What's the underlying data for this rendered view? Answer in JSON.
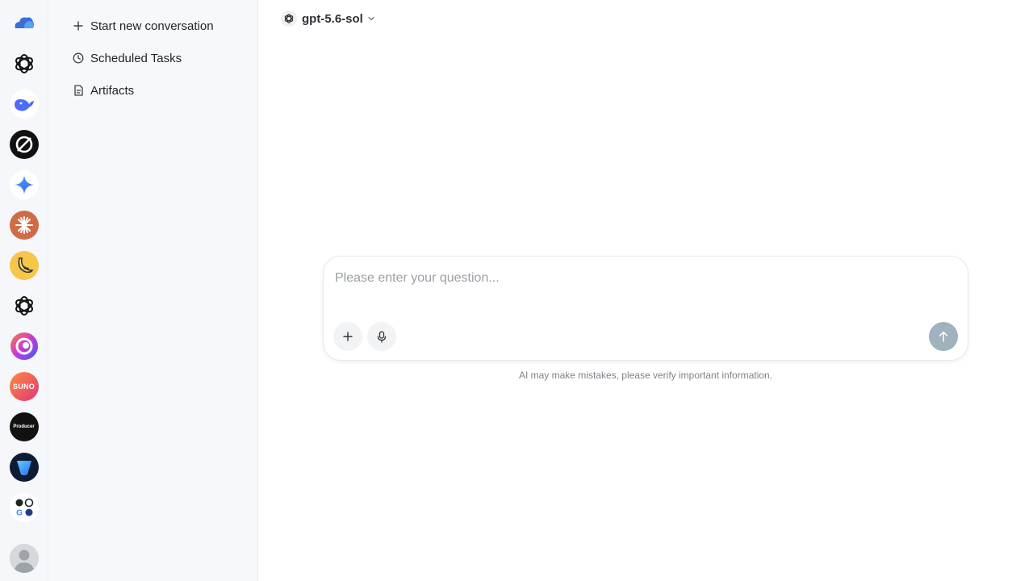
{
  "rail": {
    "apps": [
      {
        "icon": "cloud-logo-icon"
      },
      {
        "icon": "openai-logo-icon"
      },
      {
        "icon": "whale-logo-icon"
      },
      {
        "icon": "slash-circle-logo-icon"
      },
      {
        "icon": "sparkle-star-logo-icon"
      },
      {
        "icon": "starburst-logo-icon"
      },
      {
        "icon": "banana-logo-icon"
      },
      {
        "icon": "openai-logo-icon"
      },
      {
        "icon": "swirl-logo-icon"
      },
      {
        "icon": "suno-logo-icon",
        "label": "SUNO"
      },
      {
        "icon": "producer-logo-icon",
        "label": "Producer"
      },
      {
        "icon": "shield-v-logo-icon"
      },
      {
        "icon": "multi-ai-logo-icon",
        "label": "G"
      }
    ],
    "avatar": "user-avatar-icon"
  },
  "sidebar": {
    "items": [
      {
        "label": "Start new conversation",
        "icon": "plus-icon"
      },
      {
        "label": "Scheduled Tasks",
        "icon": "clock-icon"
      },
      {
        "label": "Artifacts",
        "icon": "file-icon"
      }
    ]
  },
  "header": {
    "model_name": "gpt-5.6-sol",
    "model_icon": "openai-logo-icon"
  },
  "composer": {
    "placeholder": "Please enter your question...",
    "value": "",
    "attach_icon": "plus-icon",
    "mic_icon": "microphone-icon",
    "send_icon": "arrow-up-icon"
  },
  "footer": {
    "disclaimer": "AI may make mistakes, please verify important information."
  },
  "colors": {
    "send_button": "#9fb2bd",
    "rail_bg": "#f5f7fa",
    "sidebar_bg": "#f7f8fa"
  }
}
